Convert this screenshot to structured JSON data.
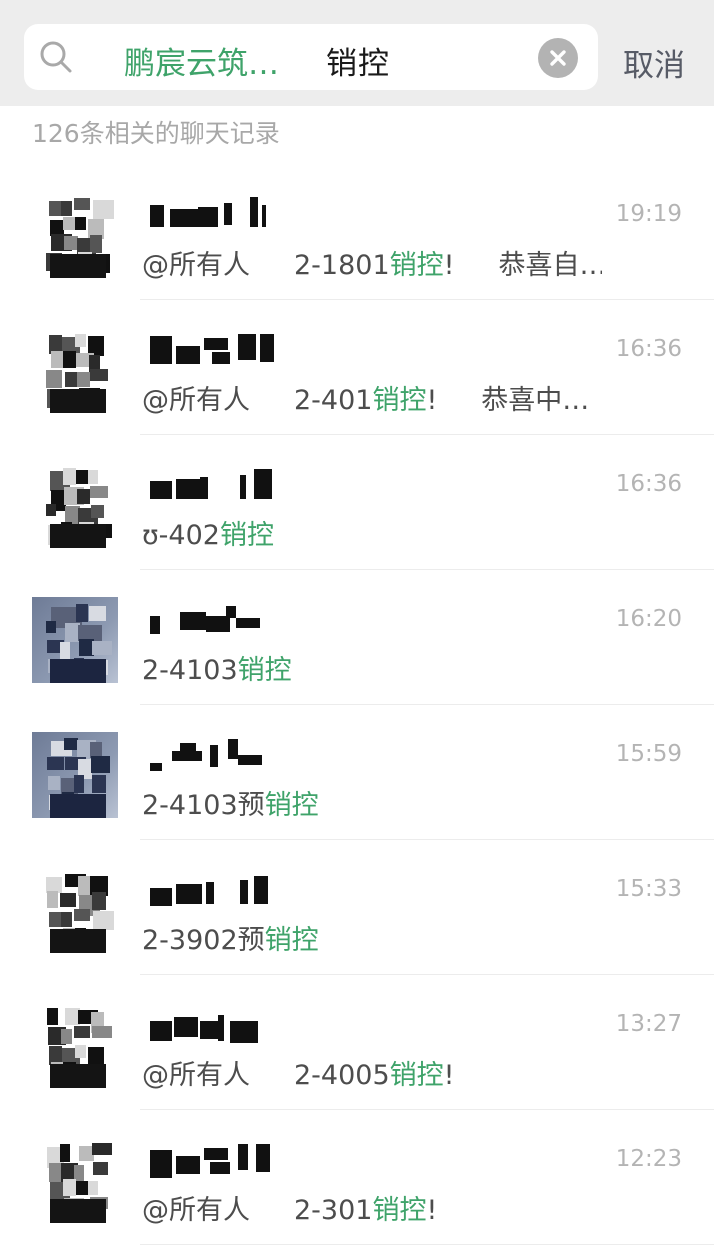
{
  "search": {
    "chat_filter": "鹏宸云筑…",
    "query": "销控",
    "cancel_label": "取消",
    "result_count": "126条相关的聊天记录"
  },
  "colors": {
    "highlight": "#3fa36a",
    "topbar": "#ededed"
  },
  "results": [
    {
      "time": "19:19",
      "prefix": "@所有人",
      "before": "2-1801",
      "keyword": "销控",
      "after": "!",
      "tail": "恭喜自…"
    },
    {
      "time": "16:36",
      "prefix": "@所有人",
      "before": "2-401",
      "keyword": "销控",
      "after": "!",
      "tail": "恭喜中…"
    },
    {
      "time": "16:36",
      "prefix": "",
      "before": "ʊ-402",
      "keyword": "销控",
      "after": "",
      "tail": ""
    },
    {
      "time": "16:20",
      "prefix": "",
      "before": "2-4103",
      "keyword": "销控",
      "after": "",
      "tail": ""
    },
    {
      "time": "15:59",
      "prefix": "",
      "before": "2-4103预",
      "keyword": "销控",
      "after": "",
      "tail": ""
    },
    {
      "time": "15:33",
      "prefix": "",
      "before": "2-3902预",
      "keyword": "销控",
      "after": "",
      "tail": ""
    },
    {
      "time": "13:27",
      "prefix": "@所有人",
      "before": "2-4005",
      "keyword": "销控",
      "after": "!",
      "tail": ""
    },
    {
      "time": "12:23",
      "prefix": "@所有人",
      "before": "2-301",
      "keyword": "销控",
      "after": "!",
      "tail": ""
    }
  ]
}
